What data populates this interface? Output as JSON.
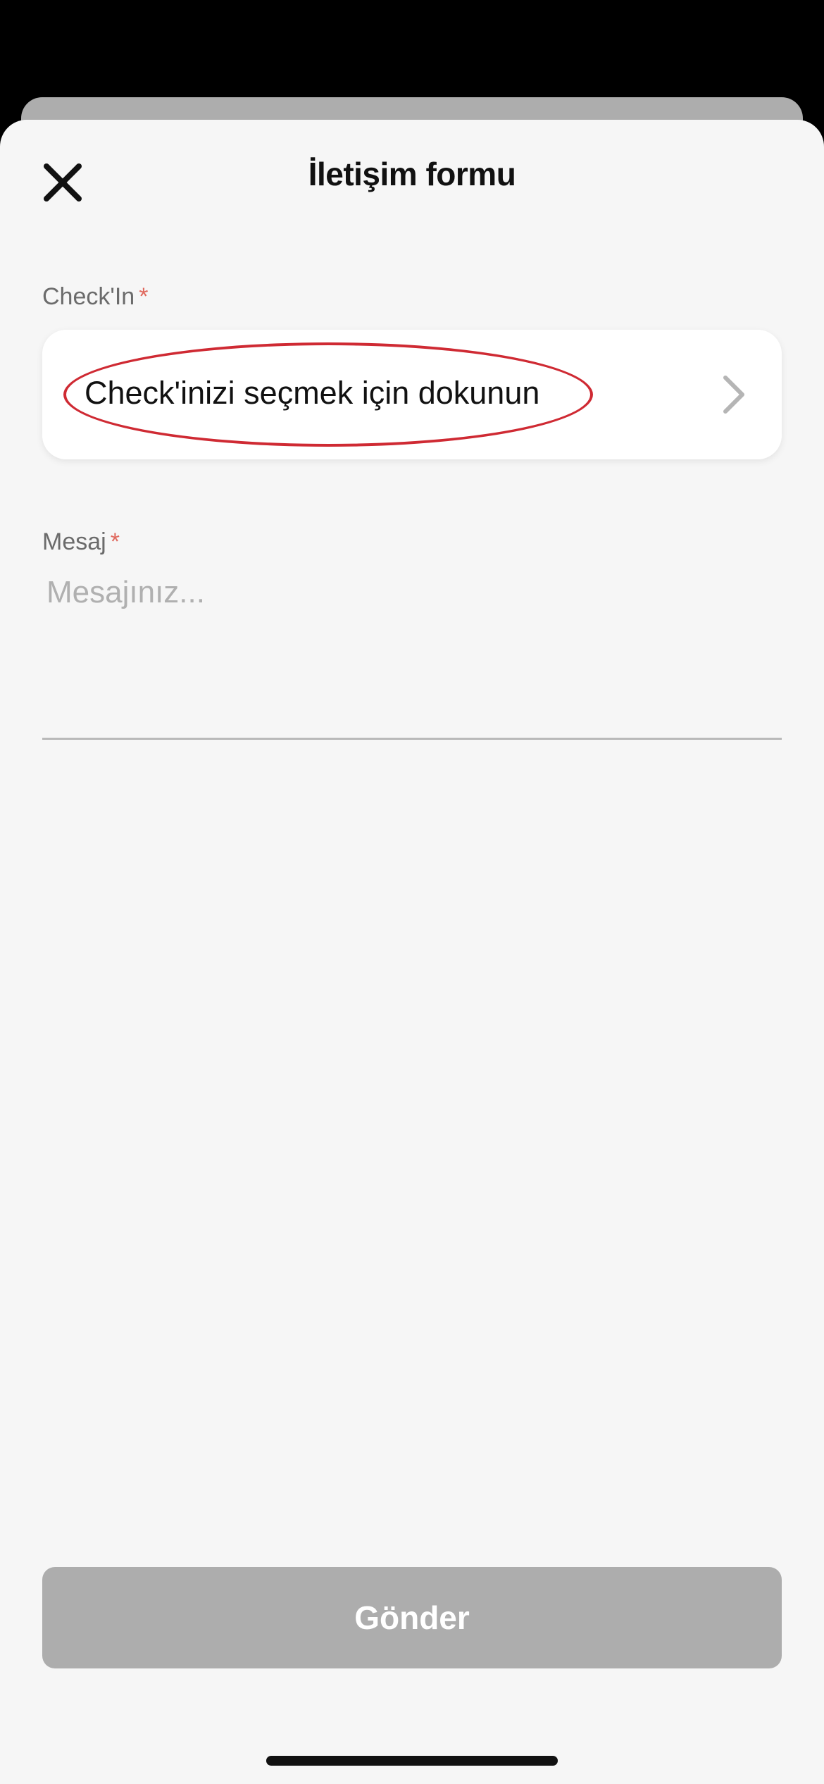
{
  "sheet": {
    "title": "İletişim formu"
  },
  "checkin": {
    "label": "Check'In",
    "required_mark": "*",
    "placeholder": "Check'inizi seçmek için dokunun"
  },
  "message": {
    "label": "Mesaj",
    "required_mark": "*",
    "placeholder": "Mesajınız...",
    "value": ""
  },
  "submit": {
    "label": "Gönder"
  },
  "icons": {
    "close": "close-icon",
    "chevron": "chevron-right-icon"
  },
  "colors": {
    "required": "#e0695e",
    "highlight": "#cf2a33",
    "button_disabled": "#adadad"
  }
}
